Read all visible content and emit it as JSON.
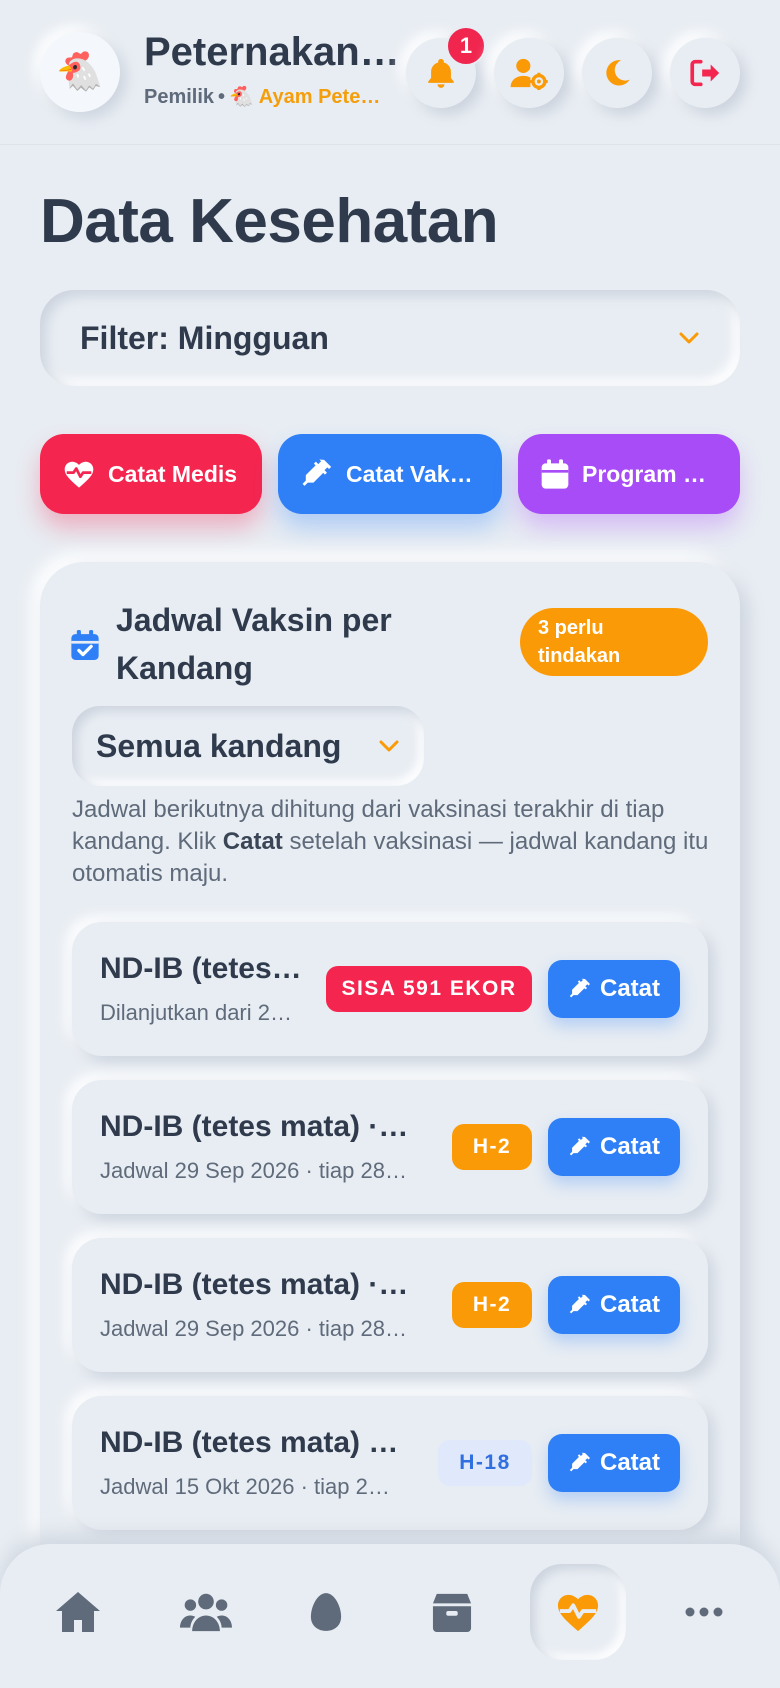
{
  "header": {
    "logo_emoji": "🐔",
    "farm_name": "Peternakan…",
    "role": "Pemilik",
    "separator": "•",
    "flock_emoji": "🐔",
    "flock_name": "Ayam Pete…",
    "notification_count": "1",
    "icons": [
      "bell-icon",
      "user-gear-icon",
      "moon-icon",
      "logout-icon"
    ]
  },
  "page": {
    "title": "Data Kesehatan"
  },
  "filter": {
    "label": "Filter: Mingguan"
  },
  "actions": {
    "medical_label": "Catat Medis",
    "vaccine_label": "Catat Vaksin",
    "program_label": "Program Va…"
  },
  "schedule": {
    "title": "Jadwal Vaksin per Kandang",
    "status_badge": "3 perlu tindakan",
    "kandang_select": "Semua kandang",
    "desc_part1": "Jadwal berikutnya dihitung dari vaksinasi terakhir di tiap kandang. Klik ",
    "desc_bold": "Catat",
    "desc_part2": " setelah vaksinasi — jadwal kandang itu otomatis maju.",
    "catat_label": "Catat",
    "rows": [
      {
        "title": "ND-IB (tetes…",
        "subtitle": "Dilanjutkan dari 2…",
        "tag": "SISA 591 EKOR",
        "tag_style": "red"
      },
      {
        "title": "ND-IB (tetes mata) · …",
        "subtitle": "Jadwal 29 Sep 2026 · tiap 28…",
        "tag": "H-2",
        "tag_style": "orange"
      },
      {
        "title": "ND-IB (tetes mata) · …",
        "subtitle": "Jadwal 29 Sep 2026 · tiap 28…",
        "tag": "H-2",
        "tag_style": "orange"
      },
      {
        "title": "ND-IB (tetes mata) · …",
        "subtitle": "Jadwal 15 Okt 2026 · tiap 2…",
        "tag": "H-18",
        "tag_style": "blue"
      }
    ]
  },
  "colors": {
    "accent_orange": "#fb9a07",
    "red": "#f4264f",
    "blue": "#2f80f7",
    "purple": "#a84cf7",
    "background": "#e8edf3"
  },
  "bottom_nav": {
    "items": [
      "home-icon",
      "users-icon",
      "egg-icon",
      "box-icon",
      "heart-pulse-icon",
      "more-icon"
    ],
    "active": "heart-pulse-icon"
  }
}
